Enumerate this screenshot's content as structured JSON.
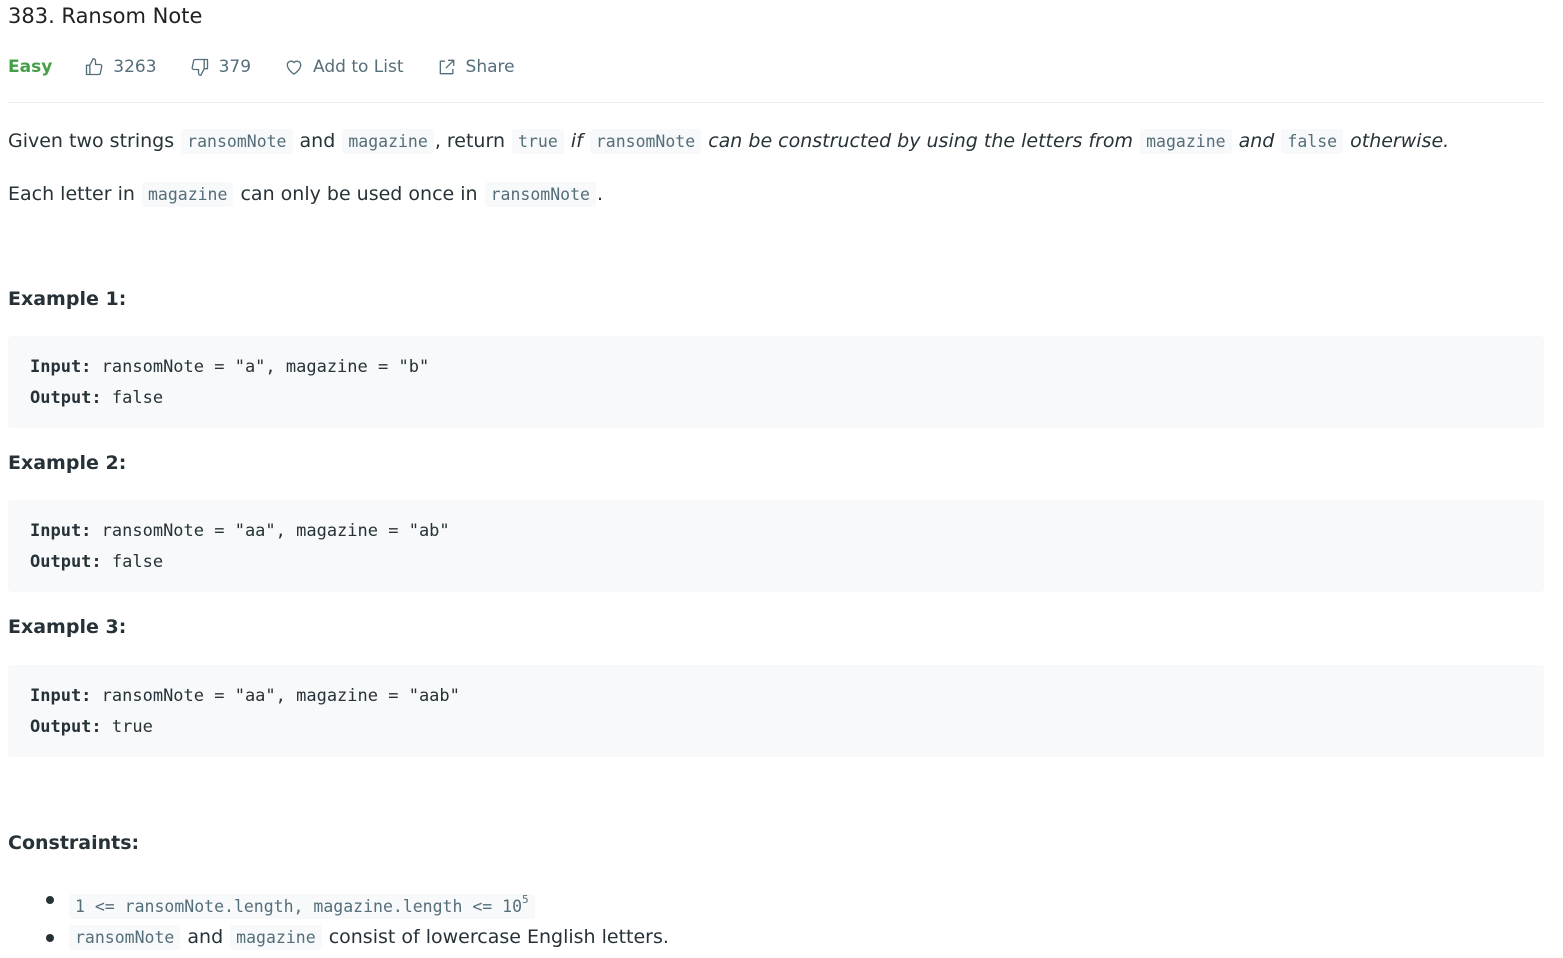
{
  "problem": {
    "title": "383. Ransom Note",
    "difficulty": "Easy",
    "likes": "3263",
    "dislikes": "379",
    "add_to_list_label": "Add to List",
    "share_label": "Share"
  },
  "description": {
    "p1": {
      "t1": "Given two strings ",
      "c1": "ransomNote",
      "t2": " and ",
      "c2": "magazine",
      "t3": ", return ",
      "c3": "true",
      "i1": " if ",
      "c4": "ransomNote",
      "i2": " can be constructed by using the letters from ",
      "c5": "magazine",
      "i3": " and ",
      "c6": "false",
      "i4": " otherwise."
    },
    "p2": {
      "t1": "Each letter in ",
      "c1": "magazine",
      "t2": " can only be used once in ",
      "c2": "ransomNote",
      "t3": "."
    }
  },
  "examples": [
    {
      "heading": "Example 1:",
      "input_label": "Input:",
      "input_value": " ransomNote = \"a\", magazine = \"b\"",
      "output_label": "Output:",
      "output_value": " false"
    },
    {
      "heading": "Example 2:",
      "input_label": "Input:",
      "input_value": " ransomNote = \"aa\", magazine = \"ab\"",
      "output_label": "Output:",
      "output_value": " false"
    },
    {
      "heading": "Example 3:",
      "input_label": "Input:",
      "input_value": " ransomNote = \"aa\", magazine = \"aab\"",
      "output_label": "Output:",
      "output_value": " true"
    }
  ],
  "constraints": {
    "heading": "Constraints:",
    "c1_code": "1 <= ransomNote.length, magazine.length <= 10",
    "c1_sup": "5",
    "c2_code1": "ransomNote",
    "c2_text1": " and ",
    "c2_code2": "magazine",
    "c2_text2": " consist of lowercase English letters."
  },
  "icons": {
    "like": "thumbs-up-icon",
    "dislike": "thumbs-down-icon",
    "add_to_list": "heart-icon",
    "share": "share-icon"
  },
  "colors": {
    "difficulty_easy": "#43a047",
    "code_background": "#f7f9fa",
    "muted_text": "#546e7a"
  }
}
